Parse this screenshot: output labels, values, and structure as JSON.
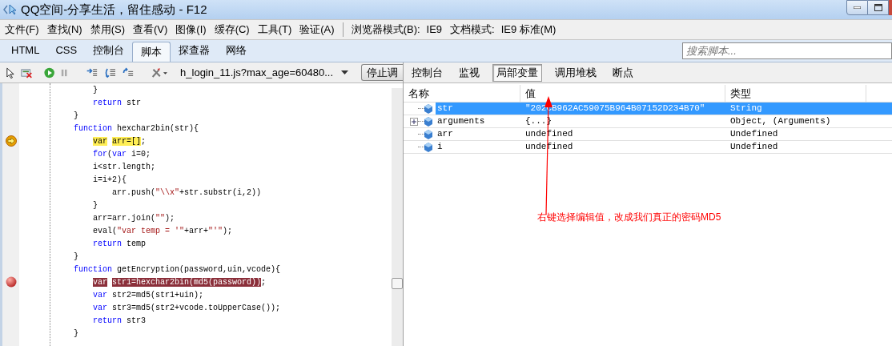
{
  "window": {
    "title": "QQ空间-分享生活，留住感动 - F12"
  },
  "menu": [
    "文件(F)",
    "查找(N)",
    "禁用(S)",
    "查看(V)",
    "图像(I)",
    "缓存(C)",
    "工具(T)",
    "验证(A)"
  ],
  "modes": [
    {
      "label": "浏览器模式(B):",
      "value": "IE9"
    },
    {
      "label": "文档模式:",
      "value": "IE9 标准(M)"
    }
  ],
  "tabs": [
    {
      "label": "HTML",
      "selected": false
    },
    {
      "label": "CSS",
      "selected": false
    },
    {
      "label": "控制台",
      "selected": false
    },
    {
      "label": "脚本",
      "selected": true
    },
    {
      "label": "探查器",
      "selected": false
    },
    {
      "label": "网络",
      "selected": false
    }
  ],
  "search": {
    "placeholder": "搜索脚本..."
  },
  "toolbar": {
    "file": "h_login_11.js?max_age=60480...",
    "stop_button": "停止调"
  },
  "code": [
    {
      "kind": "normal",
      "tokens": [
        {
          "kind": "plain",
          "text": "    }"
        }
      ]
    },
    {
      "kind": "normal",
      "tokens": [
        {
          "kind": "keyword",
          "text": "    return"
        },
        {
          "kind": "plain",
          "text": " str"
        }
      ]
    },
    {
      "kind": "normal",
      "tokens": [
        {
          "kind": "plain",
          "text": "}"
        }
      ]
    },
    {
      "kind": "normal",
      "tokens": [
        {
          "kind": "keyword",
          "text": "function"
        },
        {
          "kind": "plain",
          "text": " hexchar2bin(str){"
        }
      ]
    },
    {
      "kind": "current",
      "tokens": [
        {
          "kind": "keyword",
          "text": "    var",
          "hl": true
        },
        {
          "kind": "plain",
          "text": " arr=[]",
          "hl": true
        },
        {
          "kind": "plain",
          "text": ";",
          "hl": false
        }
      ]
    },
    {
      "kind": "normal",
      "tokens": [
        {
          "kind": "keyword",
          "text": "    for"
        },
        {
          "kind": "plain",
          "text": "("
        },
        {
          "kind": "keyword",
          "text": "var"
        },
        {
          "kind": "plain",
          "text": " i=0;"
        }
      ]
    },
    {
      "kind": "normal",
      "tokens": [
        {
          "kind": "plain",
          "text": "    i<str.length;"
        }
      ]
    },
    {
      "kind": "normal",
      "tokens": [
        {
          "kind": "plain",
          "text": "    i=i+2){"
        }
      ]
    },
    {
      "kind": "normal",
      "tokens": [
        {
          "kind": "plain",
          "text": "        arr.push("
        },
        {
          "kind": "string",
          "text": "\"\\\\x\""
        },
        {
          "kind": "plain",
          "text": "+str.substr(i,2))"
        }
      ]
    },
    {
      "kind": "normal",
      "tokens": [
        {
          "kind": "plain",
          "text": "    }"
        }
      ]
    },
    {
      "kind": "normal",
      "tokens": [
        {
          "kind": "plain",
          "text": "    arr=arr.join("
        },
        {
          "kind": "string",
          "text": "\"\""
        },
        {
          "kind": "plain",
          "text": ");"
        }
      ]
    },
    {
      "kind": "normal",
      "tokens": [
        {
          "kind": "plain",
          "text": "    eval("
        },
        {
          "kind": "string",
          "text": "\"var temp = '\""
        },
        {
          "kind": "plain",
          "text": "+arr+"
        },
        {
          "kind": "string",
          "text": "\"'\""
        },
        {
          "kind": "plain",
          "text": ");"
        }
      ]
    },
    {
      "kind": "normal",
      "tokens": [
        {
          "kind": "keyword",
          "text": "    return"
        },
        {
          "kind": "plain",
          "text": " temp"
        }
      ]
    },
    {
      "kind": "normal",
      "tokens": [
        {
          "kind": "plain",
          "text": "}"
        }
      ]
    },
    {
      "kind": "normal",
      "tokens": [
        {
          "kind": "keyword",
          "text": "function"
        },
        {
          "kind": "plain",
          "text": " getEncryption(password,uin,vcode){"
        }
      ]
    },
    {
      "kind": "breakpoint",
      "tokens": [
        {
          "kind": "keyword",
          "text": "    var",
          "hl": true
        },
        {
          "kind": "plain",
          "text": " str1=hexchar2bin(md5(password))",
          "hl": true
        },
        {
          "kind": "plain",
          "text": ";",
          "hl": false
        }
      ]
    },
    {
      "kind": "normal",
      "tokens": [
        {
          "kind": "keyword",
          "text": "    var"
        },
        {
          "kind": "plain",
          "text": " str2=md5(str1+uin);"
        }
      ]
    },
    {
      "kind": "normal",
      "tokens": [
        {
          "kind": "keyword",
          "text": "    var"
        },
        {
          "kind": "plain",
          "text": " str3=md5(str2+vcode.toUpperCase());"
        }
      ]
    },
    {
      "kind": "normal",
      "tokens": [
        {
          "kind": "keyword",
          "text": "    return"
        },
        {
          "kind": "plain",
          "text": " str3"
        }
      ]
    },
    {
      "kind": "normal",
      "tokens": [
        {
          "kind": "plain",
          "text": "}"
        }
      ]
    }
  ],
  "panel_tabs": [
    {
      "label": "控制台",
      "selected": false
    },
    {
      "label": "监视",
      "selected": false
    },
    {
      "label": "局部变量",
      "selected": true
    },
    {
      "label": "调用堆栈",
      "selected": false
    },
    {
      "label": "断点",
      "selected": false
    }
  ],
  "locals": {
    "columns": [
      "名称",
      "值",
      "类型"
    ],
    "rows": [
      {
        "name": "str",
        "value": "\"202CB962AC59075B964B07152D234B70\"",
        "type": "String",
        "expandable": false,
        "selected": true
      },
      {
        "name": "arguments",
        "value": "{...}",
        "type": "Object, (Arguments)",
        "expandable": true,
        "selected": false
      },
      {
        "name": "arr",
        "value": "undefined",
        "type": "Undefined",
        "expandable": false,
        "selected": false
      },
      {
        "name": "i",
        "value": "undefined",
        "type": "Undefined",
        "expandable": false,
        "selected": false
      }
    ]
  },
  "annotation": "右键选择编辑值，改成我们真正的密码MD5"
}
